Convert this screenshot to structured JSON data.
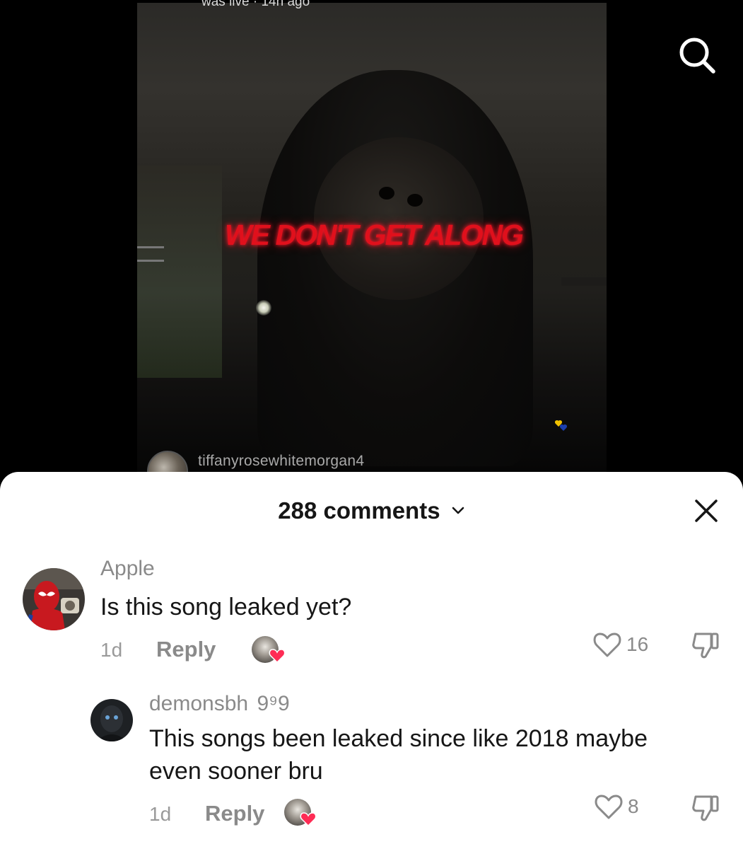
{
  "video": {
    "live_status": "was live · 14h ago",
    "song_title": "WE DON'T GET ALONG",
    "creator": "tiffanyrosewhitemorgan4"
  },
  "sheet": {
    "title": "288 comments"
  },
  "comments": [
    {
      "username": "Apple",
      "text": "Is this song leaked yet?",
      "age": "1d",
      "reply_label": "Reply",
      "likes": "16"
    },
    {
      "username": "demonsbh",
      "badge": "9⁹9",
      "text_line1": "This songs been leaked since like 2018 maybe",
      "text_line2": "even sooner bru",
      "age": "1d",
      "reply_label": "Reply",
      "likes": "8"
    }
  ],
  "icons": {
    "search": "search-icon",
    "close": "close-icon",
    "chevron": "chevron-down-icon",
    "like": "heart-outline-icon",
    "dislike": "thumbs-down-icon",
    "creator_heart": "heart-filled-icon"
  },
  "colors": {
    "title_red": "#e0101c",
    "heart_red": "#fe2c55",
    "muted_text": "#8a8a8a"
  }
}
